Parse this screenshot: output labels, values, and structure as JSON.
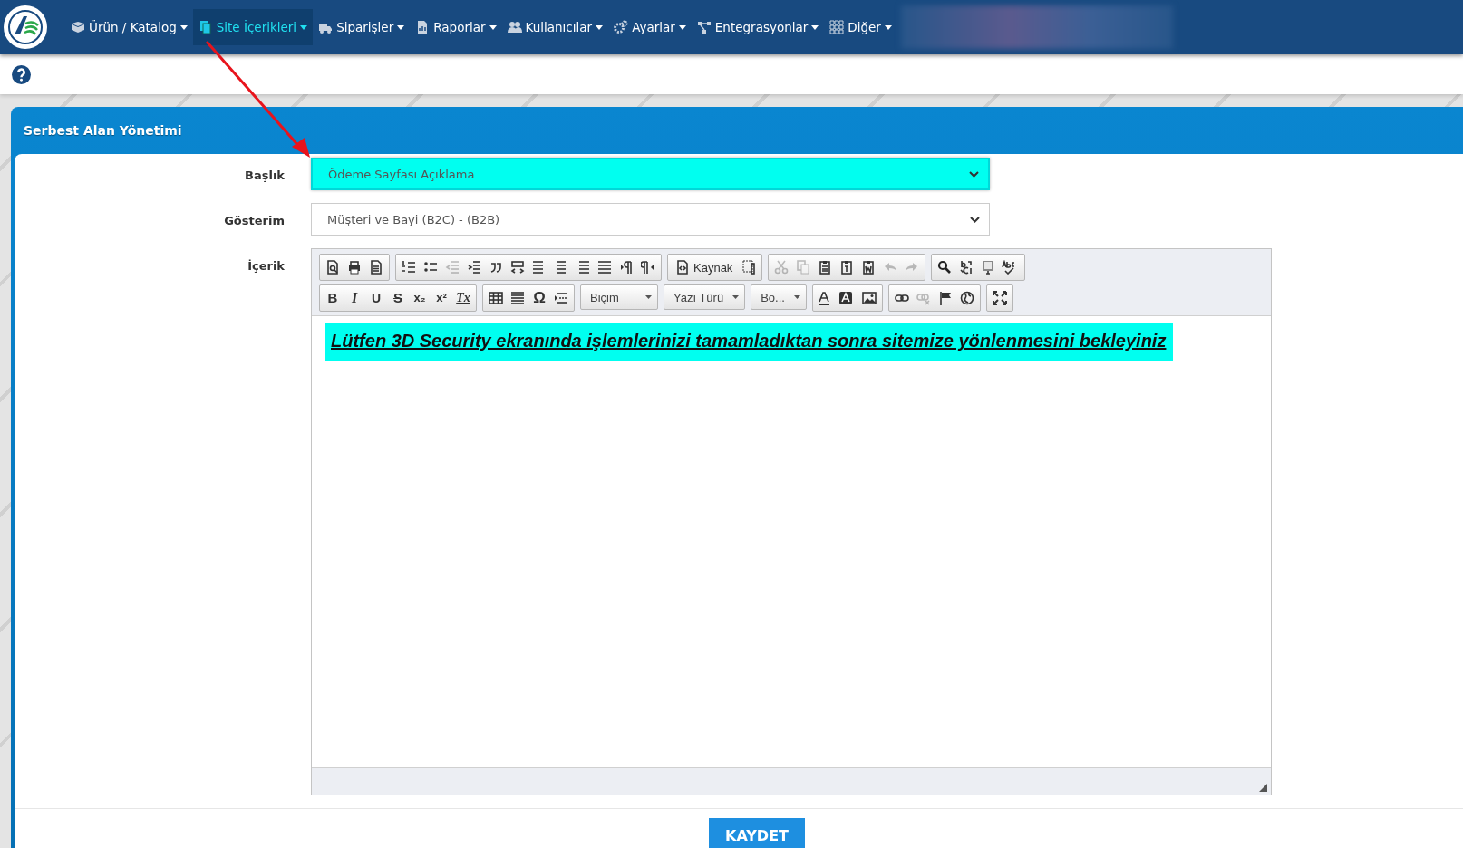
{
  "nav": {
    "items": [
      {
        "label": "Ürün / Katalog",
        "selected": false
      },
      {
        "label": "Site İçerikleri",
        "selected": true
      },
      {
        "label": "Siparişler",
        "selected": false
      },
      {
        "label": "Raporlar",
        "selected": false
      },
      {
        "label": "Kullanıcılar",
        "selected": false
      },
      {
        "label": "Ayarlar",
        "selected": false
      },
      {
        "label": "Entegrasyonlar",
        "selected": false
      },
      {
        "label": "Diğer",
        "selected": false
      }
    ]
  },
  "panel": {
    "title": "Serbest Alan Yönetimi",
    "fields": [
      {
        "kind": "select",
        "label": "Başlık",
        "value": "Ödeme Sayfası Açıklama",
        "highlighted": true
      },
      {
        "kind": "select",
        "label": "Gösterim",
        "value": "Müşteri ve Bayi (B2C) - (B2B)",
        "highlighted": false
      },
      {
        "kind": "editor",
        "label": "İçerik"
      }
    ],
    "editor": {
      "toolbar": [
        [
          [
            {
              "kind": "button",
              "disabled": false
            },
            {
              "kind": "button",
              "disabled": false
            },
            {
              "kind": "button",
              "disabled": false
            }
          ],
          [
            {
              "kind": "button",
              "disabled": false
            },
            {
              "kind": "button",
              "disabled": false
            },
            {
              "kind": "button",
              "disabled": true
            },
            {
              "kind": "button",
              "disabled": false
            },
            {
              "kind": "button",
              "disabled": false
            },
            {
              "kind": "button",
              "disabled": false
            },
            {
              "kind": "button",
              "disabled": false
            },
            {
              "kind": "button",
              "disabled": false
            },
            {
              "kind": "button",
              "disabled": false
            },
            {
              "kind": "button",
              "disabled": false
            },
            {
              "kind": "button",
              "disabled": false
            },
            {
              "kind": "button",
              "disabled": false
            }
          ],
          [
            {
              "kind": "label",
              "label": "Kaynak",
              "disabled": false
            },
            {
              "kind": "button",
              "disabled": false
            }
          ],
          [
            {
              "kind": "button",
              "disabled": true
            },
            {
              "kind": "button",
              "disabled": true
            },
            {
              "kind": "button",
              "disabled": false
            },
            {
              "kind": "button",
              "disabled": false
            },
            {
              "kind": "button",
              "disabled": false
            },
            {
              "kind": "button",
              "disabled": true
            },
            {
              "kind": "button",
              "disabled": true
            }
          ],
          [
            {
              "kind": "button",
              "disabled": false
            },
            {
              "kind": "button",
              "disabled": false
            },
            {
              "kind": "button",
              "disabled": false
            },
            {
              "kind": "button",
              "disabled": false
            }
          ]
        ],
        [
          [
            {
              "kind": "glyph",
              "glyph": "B",
              "disabled": false
            },
            {
              "kind": "glyph",
              "glyph": "I",
              "disabled": false
            },
            {
              "kind": "glyph",
              "glyph": "U",
              "disabled": false
            },
            {
              "kind": "glyph",
              "glyph": "S",
              "disabled": false
            },
            {
              "kind": "glyph",
              "glyph": "x₂",
              "disabled": false
            },
            {
              "kind": "glyph",
              "glyph": "x²",
              "disabled": false
            },
            {
              "kind": "glyph",
              "glyph": "Tx",
              "disabled": false
            }
          ],
          [
            {
              "kind": "button",
              "disabled": false
            },
            {
              "kind": "button",
              "disabled": false
            },
            {
              "kind": "glyph",
              "glyph": "Ω",
              "disabled": false
            },
            {
              "kind": "button",
              "disabled": false
            }
          ],
          [
            {
              "kind": "combo",
              "label": "Biçim"
            }
          ],
          [
            {
              "kind": "combo",
              "label": "Yazı Türü"
            }
          ],
          [
            {
              "kind": "combo",
              "label": "Bo..."
            }
          ],
          [
            {
              "kind": "button",
              "disabled": false
            },
            {
              "kind": "button",
              "disabled": false
            },
            {
              "kind": "button",
              "disabled": false
            }
          ],
          [
            {
              "kind": "button",
              "disabled": false
            },
            {
              "kind": "button",
              "disabled": true
            },
            {
              "kind": "button",
              "disabled": false
            },
            {
              "kind": "button",
              "disabled": false
            }
          ],
          [
            {
              "kind": "button",
              "disabled": false
            }
          ]
        ]
      ],
      "content": "Lütfen 3D Security ekranında işlemlerinizi tamamladıktan sonra sitemize yönlenmesini bekleyiniz"
    },
    "save_button": "KAYDET"
  }
}
